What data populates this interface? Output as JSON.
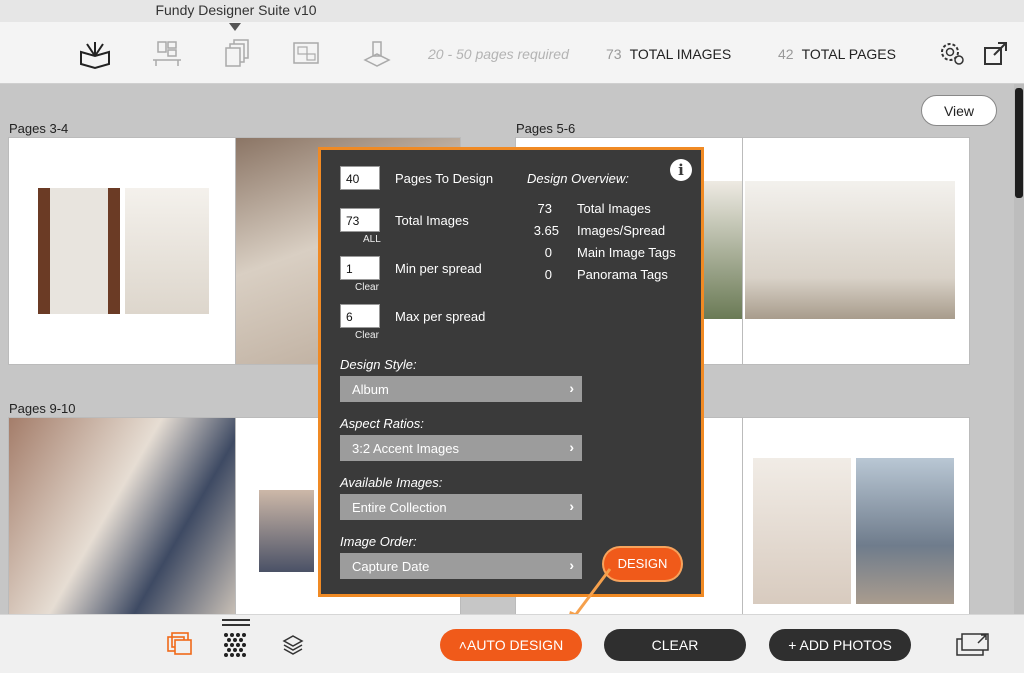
{
  "window": {
    "title": "Fundy Designer Suite v10"
  },
  "toolbar": {
    "icons": [
      "album-designer-icon",
      "wall-art-icon",
      "pages-icon",
      "layout-icon",
      "proofing-icon"
    ],
    "pages_required": "20 - 50 pages required",
    "total_images_num": "73",
    "total_images_label": "TOTAL IMAGES",
    "total_pages_num": "42",
    "total_pages_label": "TOTAL PAGES",
    "settings_icon": "gear-icon",
    "export_icon": "export-icon"
  },
  "canvas": {
    "view_button": "View",
    "spreads": [
      {
        "label": "Pages 3-4"
      },
      {
        "label": "Pages 5-6"
      },
      {
        "label": "Pages 9-10"
      }
    ]
  },
  "popup": {
    "fields": [
      {
        "value": "40",
        "label": "Pages To Design",
        "link": ""
      },
      {
        "value": "73",
        "label": "Total Images",
        "link": "ALL"
      },
      {
        "value": "1",
        "label": "Min per spread",
        "link": "Clear"
      },
      {
        "value": "6",
        "label": "Max per spread",
        "link": "Clear"
      }
    ],
    "overview_heading": "Design Overview:",
    "overview": [
      {
        "num": "73",
        "label": "Total Images"
      },
      {
        "num": "3.65",
        "label": "Images/Spread"
      },
      {
        "num": "0",
        "label": "Main Image Tags"
      },
      {
        "num": "0",
        "label": "Panorama Tags"
      }
    ],
    "design_style": {
      "heading": "Design Style:",
      "value": "Album"
    },
    "aspect_ratios": {
      "heading": "Aspect Ratios:",
      "value": "3:2 Accent Images"
    },
    "available_images": {
      "heading": "Available Images:",
      "value": "Entire Collection"
    },
    "image_order": {
      "heading": "Image Order:",
      "value": "Capture Date"
    },
    "design_button": "DESIGN",
    "info_icon": "i"
  },
  "bottombar": {
    "auto_design": "AUTO DESIGN",
    "clear": "CLEAR",
    "add_photos": "+ ADD PHOTOS"
  },
  "colors": {
    "accent_orange": "#f05a1a",
    "popup_bg": "#3a3a3a",
    "dark_pill": "#2f2f2f"
  }
}
